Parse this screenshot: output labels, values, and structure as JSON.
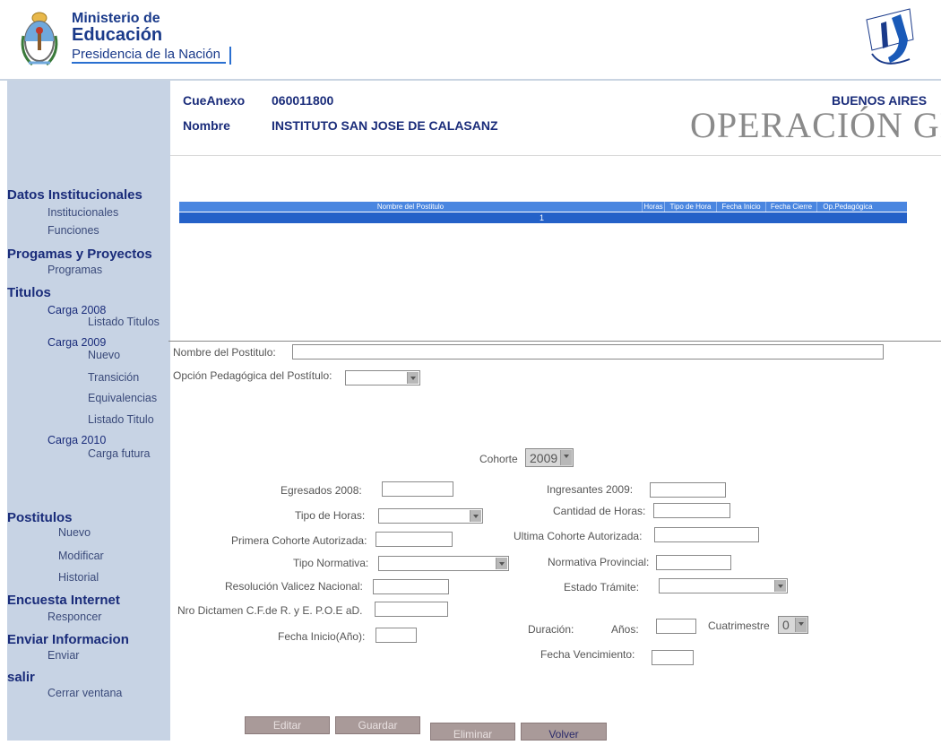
{
  "header": {
    "ministry_line1": "Ministerio de",
    "ministry_line2": "Educación",
    "ministry_line3": "Presidencia de la Nación"
  },
  "institution": {
    "cue_label": "CueAnexo",
    "cue_value": "060011800",
    "name_label": "Nombre",
    "name_value": "INSTITUTO SAN JOSE DE CALASANZ",
    "province": "BUENOS AIRES",
    "banner": "OPERACIÓN GE"
  },
  "sidebar": {
    "datos": "Datos Institucionales",
    "institucionales": "Institucionales",
    "funciones": "Funciones",
    "progamas": "Progamas y Proyectos",
    "programas": "Programas",
    "titulos": "Titulos",
    "carga2008": "Carga 2008",
    "listado_titulos": "Listado Titulos",
    "carga2009": "Carga 2009",
    "nuevo": "Nuevo",
    "transicion": "Transición",
    "equivalencias": "Equivalencias",
    "listado_titulo": "Listado Titulo",
    "carga2010": "Carga 2010",
    "carga_futura": "Carga futura",
    "postitulos": "Postitulos",
    "p_nuevo": "Nuevo",
    "p_modificar": "Modificar",
    "p_historial": "Historial",
    "encuesta": "Encuesta Internet",
    "responder": "Responcer",
    "enviar_info": "Enviar Informacion",
    "enviar": "Enviar",
    "salir": "salir",
    "cerrar": "Cerrar ventana"
  },
  "table": {
    "columns": [
      "Nombre del Postitulo",
      "Horas",
      "Tipo de Hora",
      "Fecha Inicio",
      "Fecha Cierre",
      "Op.Pedagógica"
    ],
    "page": "1"
  },
  "form": {
    "nombre_postitulo_label": "Nombre del Postitulo:",
    "opcion_pedagogica_label": "Opción Pedagógica del Postítulo:",
    "cohorte_label": "Cohorte",
    "cohorte_value": "2009",
    "egresados_label": "Egresados 2008:",
    "ingresantes_label": "Ingresantes 2009:",
    "tipo_horas_label": "Tipo de Horas:",
    "cantidad_horas_label": "Cantidad de Horas:",
    "primera_cohorte_label": "Primera Cohorte Autorizada:",
    "ultima_cohorte_label": "Ultima Cohorte Autorizada:",
    "tipo_normativa_label": "Tipo Normativa:",
    "normativa_provincial_label": "Normativa Provincial:",
    "resolucion_label": "Resolución Valicez Nacional:",
    "estado_tramite_label": "Estado Trámite:",
    "dictamen_label": "Nro Dictamen C.F.de R. y E. P.O.E aD.",
    "fecha_inicio_label": "Fecha Inicio(Año):",
    "duracion_label": "Duración:",
    "anios_label": "Años:",
    "cuatrimestre_label": "Cuatrimestre",
    "cuatrimestre_value": "0",
    "fecha_vencimiento_label": "Fecha Vencimiento:"
  },
  "buttons": {
    "editar": "Editar",
    "guardar": "Guardar",
    "eliminar": "Eliminar",
    "volver": "Volver"
  }
}
